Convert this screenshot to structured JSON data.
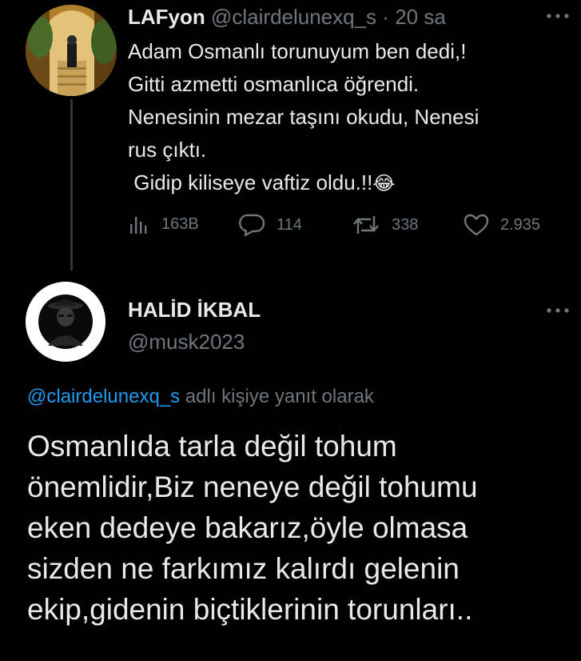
{
  "parent_tweet": {
    "display_name": "LAFyon",
    "handle": "@clairdelunexq_s",
    "separator": "·",
    "time": "20 sa",
    "text_lines": [
      "Adam Osmanlı torunuyum ben dedi,!",
      "Gitti azmetti osmanlıca öğrendi.",
      "Nenesinin mezar taşını okudu, Nenesi",
      "rus çıktı.",
      " Gidip kiliseye vaftiz oldu.!!"
    ],
    "emoji": "😂",
    "emoji_name": "face-with-tears-of-joy",
    "stats": {
      "views": "163B",
      "replies": "114",
      "retweets": "338",
      "likes": "2.935"
    },
    "more_icon": "more-horizontal-icon"
  },
  "reply_tweet": {
    "display_name": "HALİD İKBAL",
    "handle": "@musk2023",
    "replying_to_handle": "@clairdelunexq_s",
    "replying_to_suffix": " adlı kişiye yanıt olarak",
    "text_lines": [
      "Osmanlıda tarla değil tohum",
      "önemlidir,Biz neneye değil tohumu",
      "eken dedeye bakarız,öyle olmasa",
      "sizden ne farkımız kalırdı gelenin",
      "ekip,gidenin biçtiklerinin torunları.."
    ],
    "more_icon": "more-horizontal-icon"
  },
  "colors": {
    "background": "#000000",
    "text_primary": "#e7e9ea",
    "text_secondary": "#71767b",
    "link": "#1d9bf0",
    "thread_line": "#333639"
  }
}
